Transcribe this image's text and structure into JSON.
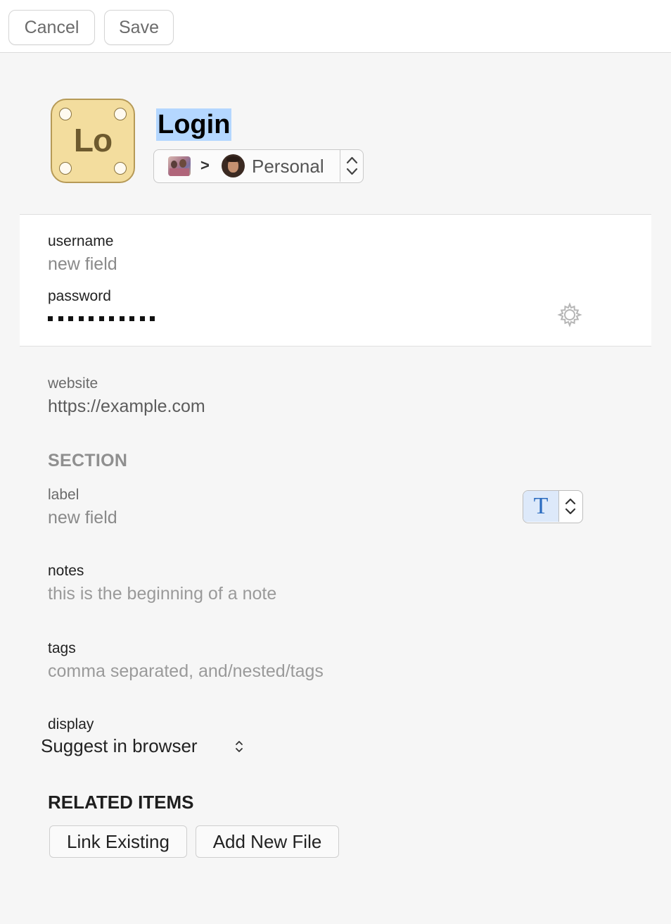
{
  "toolbar": {
    "cancel_label": "Cancel",
    "save_label": "Save"
  },
  "item": {
    "icon_text": "Lo",
    "icon_color": "#f3dd9e",
    "title": "Login",
    "vault": {
      "account_avatar": "family-avatar",
      "separator": ">",
      "owner_avatar": "person-avatar",
      "name": "Personal"
    }
  },
  "fields": {
    "username": {
      "label": "username",
      "placeholder": "new field"
    },
    "password": {
      "label": "password",
      "mask_length": 11,
      "generator_icon": "gear-icon"
    }
  },
  "website": {
    "label": "website",
    "value": "https://example.com"
  },
  "section": {
    "title": "SECTION",
    "field": {
      "label": "label",
      "placeholder": "new field",
      "type_glyph": "T"
    }
  },
  "notes": {
    "label": "notes",
    "placeholder": "this is the beginning of a note"
  },
  "tags": {
    "label": "tags",
    "placeholder": "comma separated, and/nested/tags"
  },
  "display": {
    "label": "display",
    "selected": "Suggest in browser"
  },
  "related": {
    "title": "RELATED ITEMS",
    "link_existing_label": "Link Existing",
    "add_new_file_label": "Add New File"
  },
  "colors": {
    "title_highlight": "#b4d7ff",
    "type_picker_accent": "#2b6cc0"
  }
}
